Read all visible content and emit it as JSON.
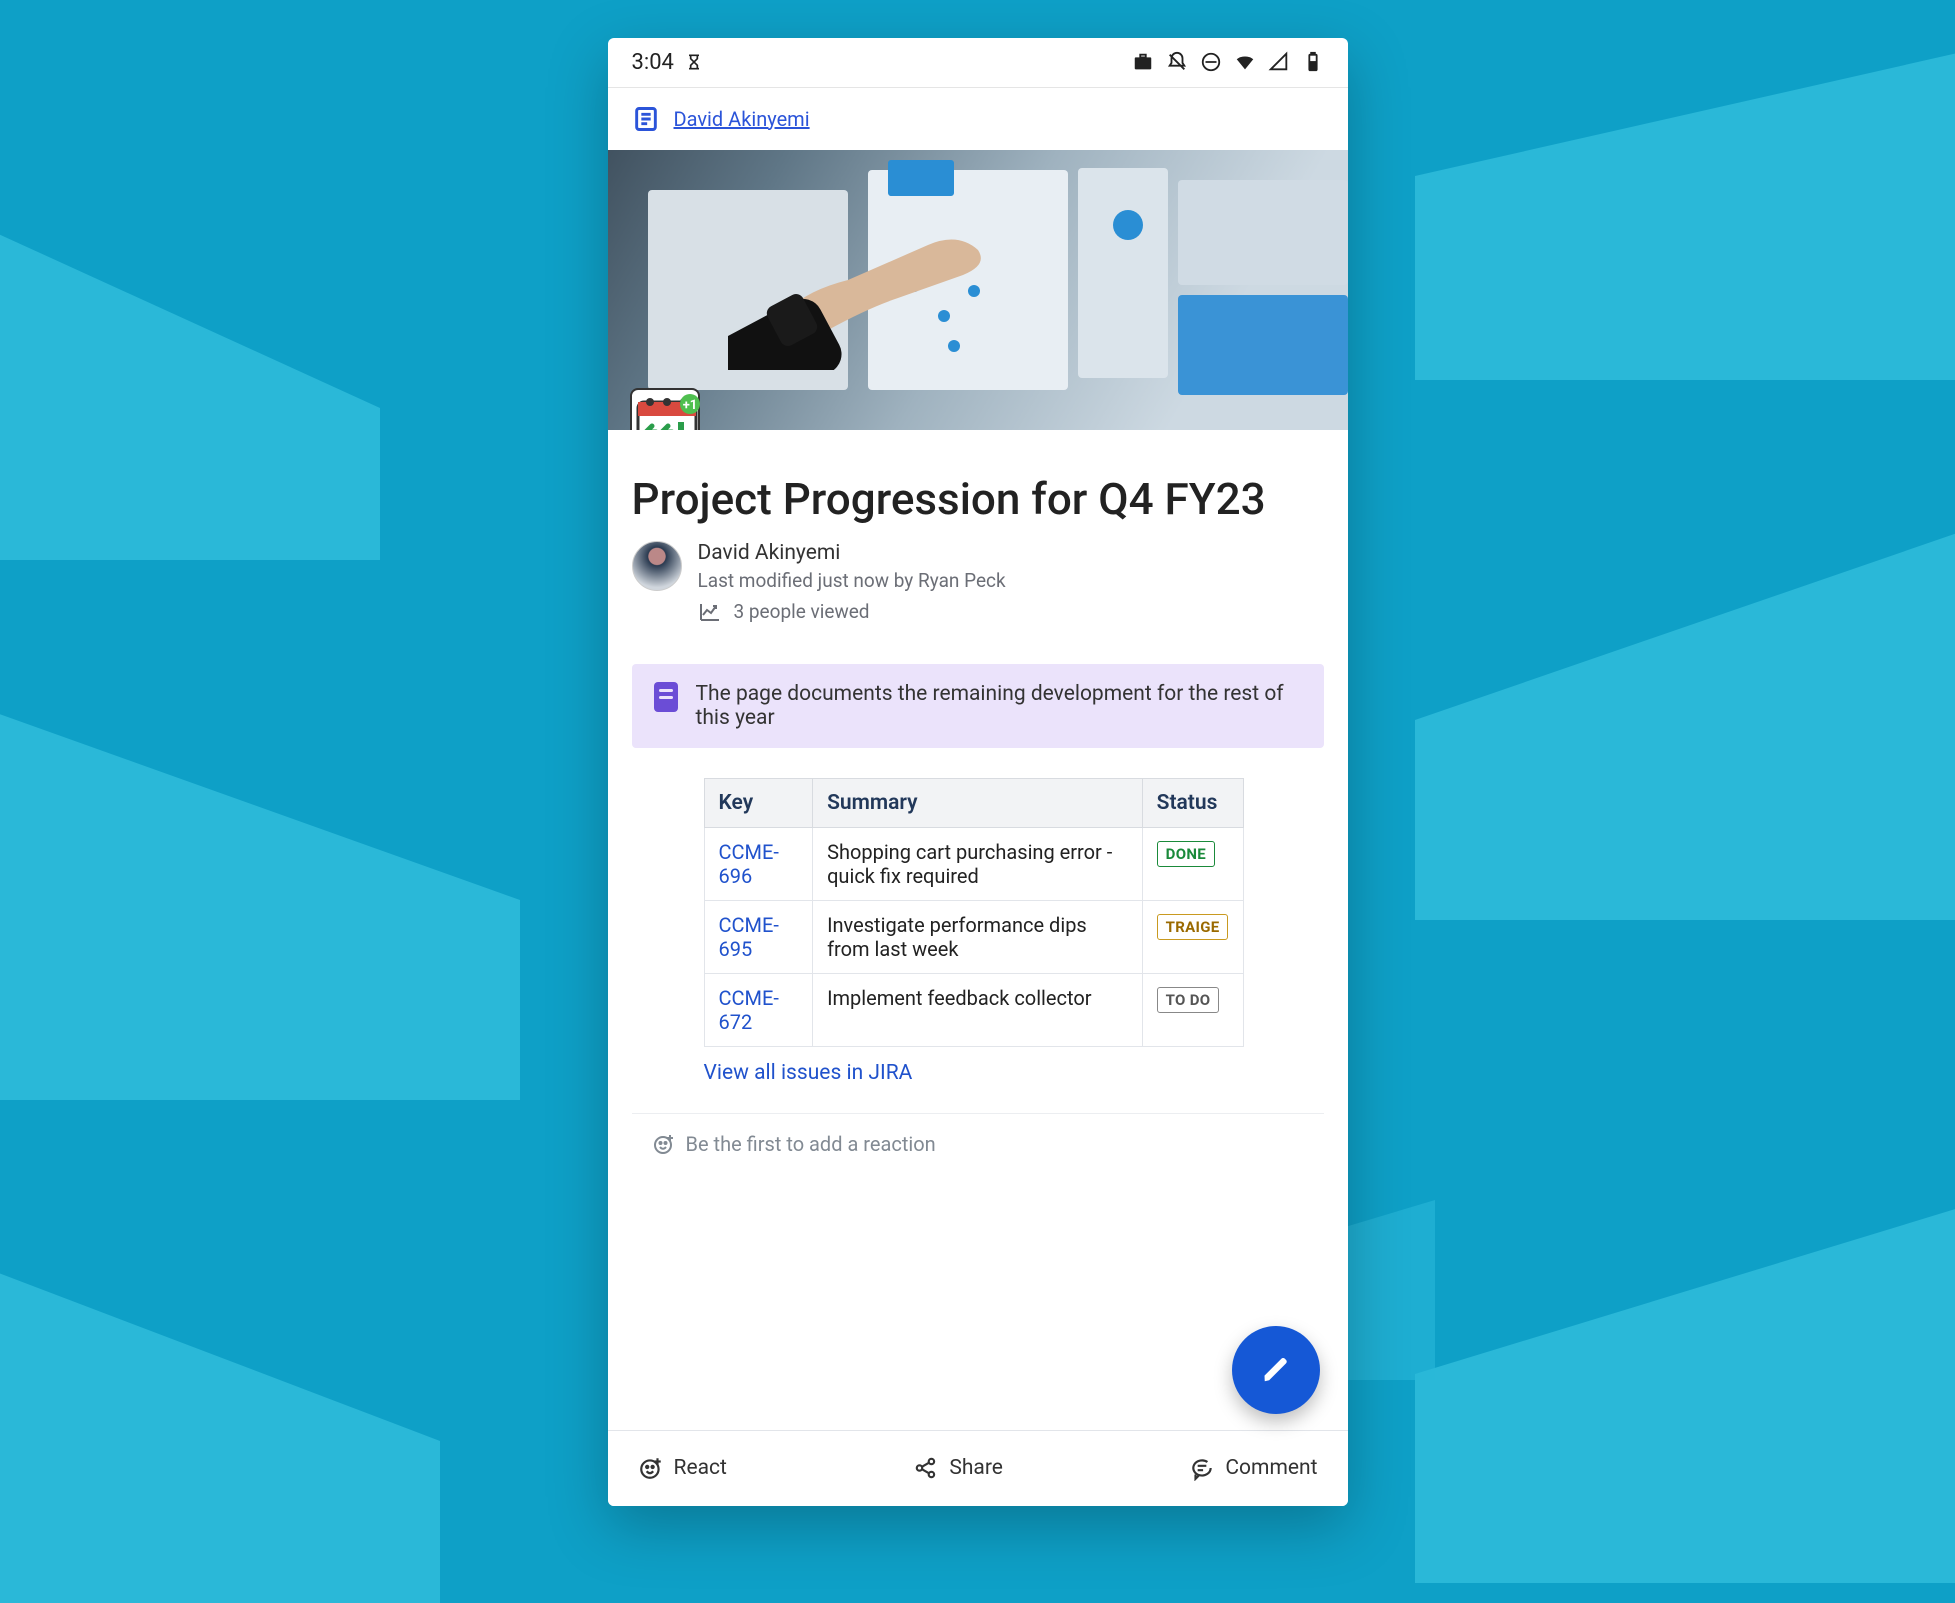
{
  "status_bar": {
    "time": "3:04"
  },
  "breadcrumb": {
    "author_link": "David Akinyemi"
  },
  "page": {
    "title": "Project Progression for Q4 FY23",
    "author": "David Akinyemi",
    "modified": "Last modified just now by Ryan Peck",
    "views": "3 people viewed"
  },
  "info_panel": {
    "text": "The page documents the remaining development for the rest of this year"
  },
  "jira": {
    "headers": {
      "key": "Key",
      "summary": "Summary",
      "status": "Status"
    },
    "rows": [
      {
        "key": "CCME-696",
        "summary": "Shopping cart purchasing error - quick fix required",
        "status": "DONE",
        "status_class": "b-done"
      },
      {
        "key": "CCME-695",
        "summary": "Investigate performance dips from last week",
        "status": "TRAIGE",
        "status_class": "b-triage"
      },
      {
        "key": "CCME-672",
        "summary": "Implement feedback collector",
        "status": "TO DO",
        "status_class": "b-todo"
      }
    ],
    "view_all": "View all issues in JIRA"
  },
  "reactions": {
    "hint": "Be the first to add a reaction"
  },
  "bottom_bar": {
    "react": "React",
    "share": "Share",
    "comment": "Comment"
  }
}
